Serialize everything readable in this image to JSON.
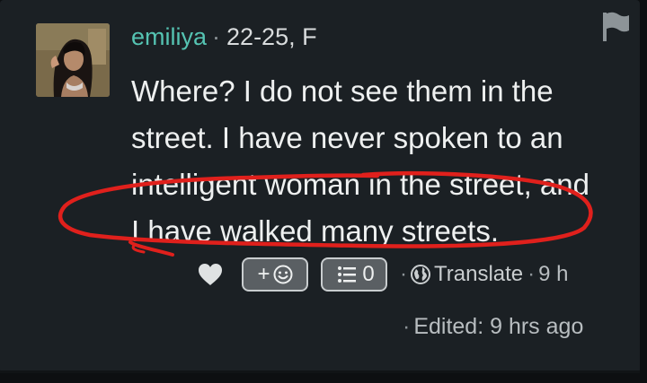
{
  "post": {
    "username": "emiliya",
    "separator": "·",
    "user_info": "22-25, F",
    "message": "Where? I do not see them in the street. I have never spoken to an intelligent woman in the street, and I have walked many streets.",
    "reaction_add_label": "+",
    "comment_count": "0",
    "translate_label": "Translate",
    "time_ago": "9 h",
    "edited_label": "Edited: 9 hrs ago"
  },
  "icons": {
    "report": "flag-icon",
    "like": "heart-icon",
    "reaction": "smiley-icon",
    "comments": "list-icon",
    "translate": "globe-icon"
  },
  "colors": {
    "card_background": "#1b2024",
    "username": "#55c3b2",
    "annotation": "#e0201c"
  }
}
